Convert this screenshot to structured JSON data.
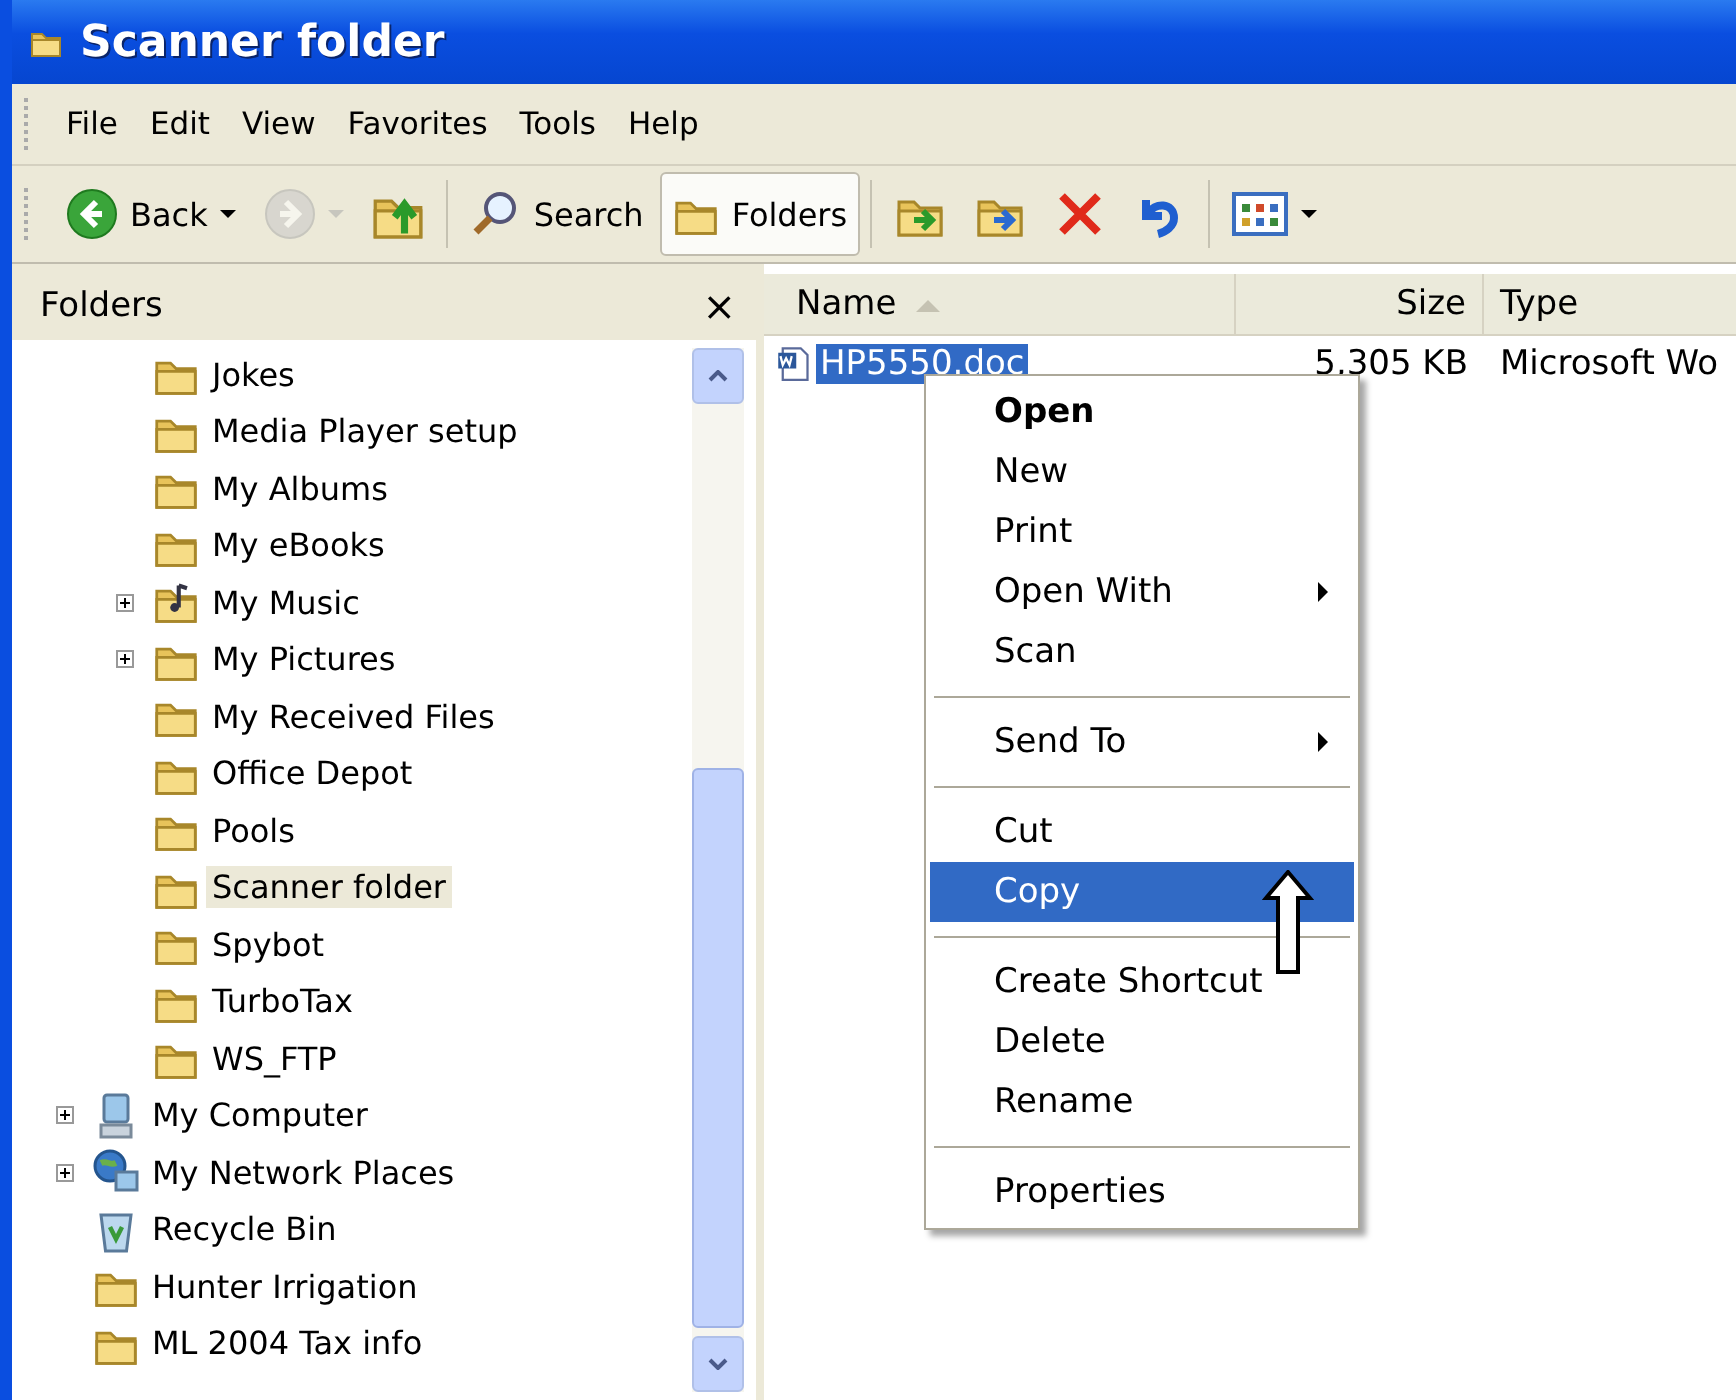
{
  "window": {
    "title": "Scanner folder"
  },
  "menu_bar": [
    "File",
    "Edit",
    "View",
    "Favorites",
    "Tools",
    "Help"
  ],
  "toolbar": [
    {
      "kind": "back",
      "label": "Back",
      "disabled": false,
      "selected": false
    },
    {
      "kind": "forward",
      "disabled": true,
      "selected": false
    },
    {
      "kind": "up",
      "disabled": false,
      "selected": false
    },
    {
      "kind": "search",
      "label": "Search",
      "disabled": false,
      "selected": false
    },
    {
      "kind": "folders",
      "label": "Folders",
      "disabled": false,
      "selected": true
    },
    {
      "kind": "move",
      "disabled": false,
      "selected": false
    },
    {
      "kind": "copy",
      "disabled": false,
      "selected": false
    },
    {
      "kind": "delete",
      "disabled": false,
      "selected": false
    },
    {
      "kind": "undo",
      "disabled": false,
      "selected": false
    },
    {
      "kind": "views",
      "disabled": false,
      "selected": false
    }
  ],
  "folders_pane": {
    "title": "Folders",
    "close": "×",
    "tree": [
      {
        "children": [
          {
            "label": "Jokes",
            "kind": "folder",
            "expandable": false,
            "selected": false
          },
          {
            "label": "Media Player setup",
            "kind": "folder",
            "expandable": false,
            "selected": false
          },
          {
            "label": "My Albums",
            "kind": "folder",
            "expandable": false,
            "selected": false
          },
          {
            "label": "My eBooks",
            "kind": "folder",
            "expandable": false,
            "selected": false
          },
          {
            "label": "My Music",
            "kind": "music",
            "expandable": true,
            "selected": false
          },
          {
            "label": "My Pictures",
            "kind": "folder",
            "expandable": true,
            "selected": false
          },
          {
            "label": "My Received Files",
            "kind": "folder",
            "expandable": false,
            "selected": false
          },
          {
            "label": "Office Depot",
            "kind": "folder",
            "expandable": false,
            "selected": false
          },
          {
            "label": "Pools",
            "kind": "folder",
            "expandable": false,
            "selected": false
          },
          {
            "label": "Scanner folder",
            "kind": "folder",
            "expandable": false,
            "selected": true
          },
          {
            "label": "Spybot",
            "kind": "folder",
            "expandable": false,
            "selected": false
          },
          {
            "label": "TurboTax",
            "kind": "folder",
            "expandable": false,
            "selected": false
          },
          {
            "label": "WS_FTP",
            "kind": "folder",
            "expandable": false,
            "selected": false
          }
        ]
      },
      {
        "label": "My Computer",
        "kind": "computer",
        "expandable": true,
        "selected": false
      },
      {
        "label": "My Network Places",
        "kind": "network",
        "expandable": true,
        "selected": false
      },
      {
        "label": "Recycle Bin",
        "kind": "recycle",
        "expandable": false,
        "selected": false
      },
      {
        "label": "Hunter Irrigation",
        "kind": "folder",
        "expandable": false,
        "selected": false
      },
      {
        "label": "ML 2004 Tax info",
        "kind": "folder",
        "expandable": false,
        "selected": false
      }
    ]
  },
  "file_list": {
    "columns": [
      {
        "label": "Name",
        "sorted": true
      },
      {
        "label": "Size",
        "sorted": false
      },
      {
        "label": "Type",
        "sorted": false
      }
    ],
    "rows": [
      {
        "name": "HP5550.doc",
        "size": "5,305 KB",
        "type": "Microsoft Wo",
        "selected": true
      }
    ]
  },
  "context_menu": [
    {
      "kind": "item",
      "label": "Open",
      "default": true,
      "submenu": false,
      "selected": false
    },
    {
      "kind": "item",
      "label": "New",
      "default": false,
      "submenu": false,
      "selected": false
    },
    {
      "kind": "item",
      "label": "Print",
      "default": false,
      "submenu": false,
      "selected": false
    },
    {
      "kind": "item",
      "label": "Open With",
      "default": false,
      "submenu": true,
      "selected": false
    },
    {
      "kind": "item",
      "label": "Scan",
      "default": false,
      "submenu": false,
      "selected": false
    },
    {
      "kind": "separator"
    },
    {
      "kind": "item",
      "label": "Send To",
      "default": false,
      "submenu": true,
      "selected": false
    },
    {
      "kind": "separator"
    },
    {
      "kind": "item",
      "label": "Cut",
      "default": false,
      "submenu": false,
      "selected": false
    },
    {
      "kind": "item",
      "label": "Copy",
      "default": false,
      "submenu": false,
      "selected": true
    },
    {
      "kind": "separator"
    },
    {
      "kind": "item",
      "label": "Create Shortcut",
      "default": false,
      "submenu": false,
      "selected": false
    },
    {
      "kind": "item",
      "label": "Delete",
      "default": false,
      "submenu": false,
      "selected": false
    },
    {
      "kind": "item",
      "label": "Rename",
      "default": false,
      "submenu": false,
      "selected": false
    },
    {
      "kind": "separator"
    },
    {
      "kind": "item",
      "label": "Properties",
      "default": false,
      "submenu": false,
      "selected": false
    }
  ]
}
